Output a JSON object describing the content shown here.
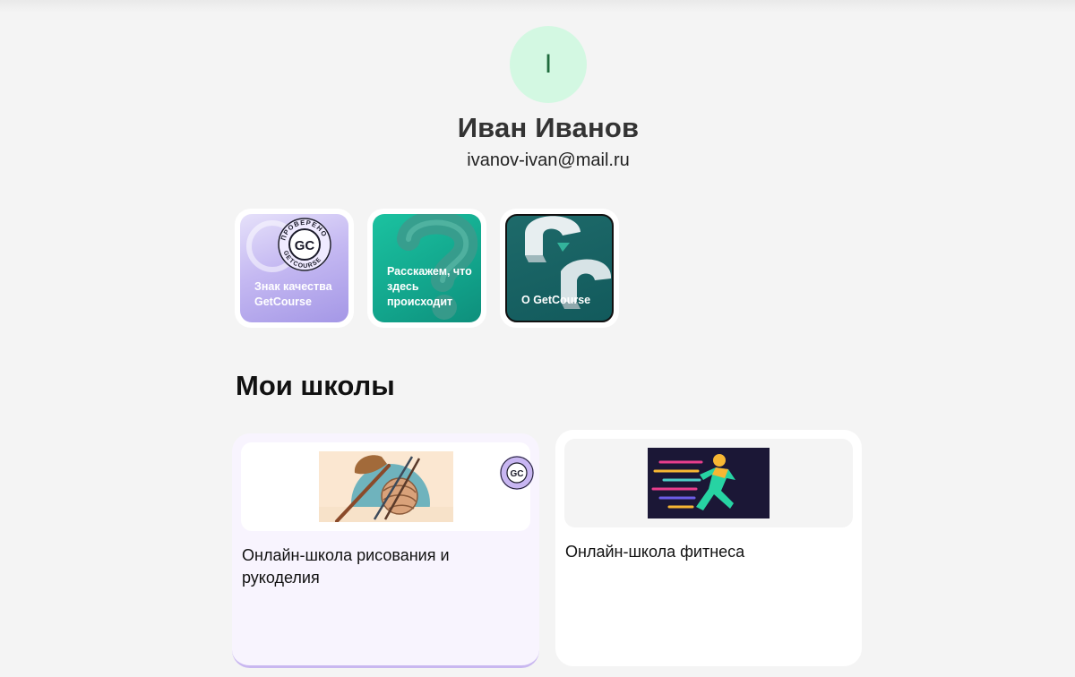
{
  "profile": {
    "initial": "I",
    "name": "Иван Иванов",
    "email": "ivanov-ivan@mail.ru",
    "avatar_color": "#d3f8e2"
  },
  "stories": [
    {
      "label": "Знак качества GetCourse",
      "badge_text_top": "ПРОВЕРЕНО",
      "badge_text_bottom": "GETCOURSE",
      "badge_mark": "GC",
      "icon": "quality-badge-icon"
    },
    {
      "label": "Расскажем, что здесь происходит",
      "icon": "question-mark-icon"
    },
    {
      "label": "О GetCourse",
      "icon": "getcourse-logo-icon"
    }
  ],
  "schools_section": {
    "title": "Мои школы"
  },
  "schools": [
    {
      "name": "Онлайн-школа рисования и рукоделия",
      "verified": true,
      "badge_mark": "GC",
      "cover_icon": "brush-yarn-icon",
      "accent": "#c9b7f0"
    },
    {
      "name": "Онлайн-школа фитнеса",
      "verified": false,
      "cover_icon": "runner-icon"
    }
  ]
}
